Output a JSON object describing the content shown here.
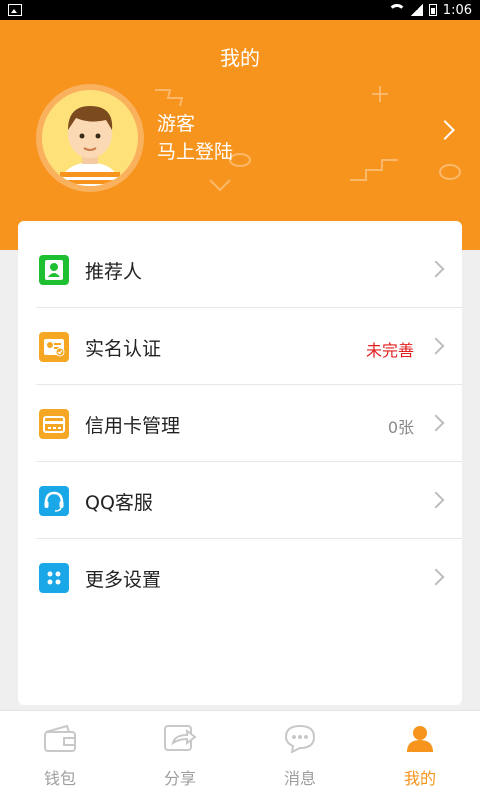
{
  "status_bar": {
    "time": "1:06"
  },
  "header": {
    "title": "我的",
    "user_name": "游客",
    "login_prompt": "马上登陆"
  },
  "menu": [
    {
      "label": "推荐人",
      "value": "",
      "icon": "contact-card-icon",
      "icon_color": "#1ec032"
    },
    {
      "label": "实名认证",
      "value": "未完善",
      "value_color": "#e02020",
      "icon": "verification-card-icon",
      "icon_color": "#f5a623"
    },
    {
      "label": "信用卡管理",
      "value": "0张",
      "value_color": "#888888",
      "icon": "credit-card-icon",
      "icon_color": "#f5a623"
    },
    {
      "label": "QQ客服",
      "value": "",
      "icon": "headset-icon",
      "icon_color": "#1aa7e8"
    },
    {
      "label": "更多设置",
      "value": "",
      "icon": "grid-icon",
      "icon_color": "#1aa7e8"
    }
  ],
  "nav": [
    {
      "label": "钱包",
      "icon": "wallet-icon",
      "active": false
    },
    {
      "label": "分享",
      "icon": "share-icon",
      "active": false
    },
    {
      "label": "消息",
      "icon": "message-icon",
      "active": false
    },
    {
      "label": "我的",
      "icon": "user-icon",
      "active": true
    }
  ],
  "colors": {
    "brand": "#f7941d",
    "inactive": "#c8c8c8"
  }
}
